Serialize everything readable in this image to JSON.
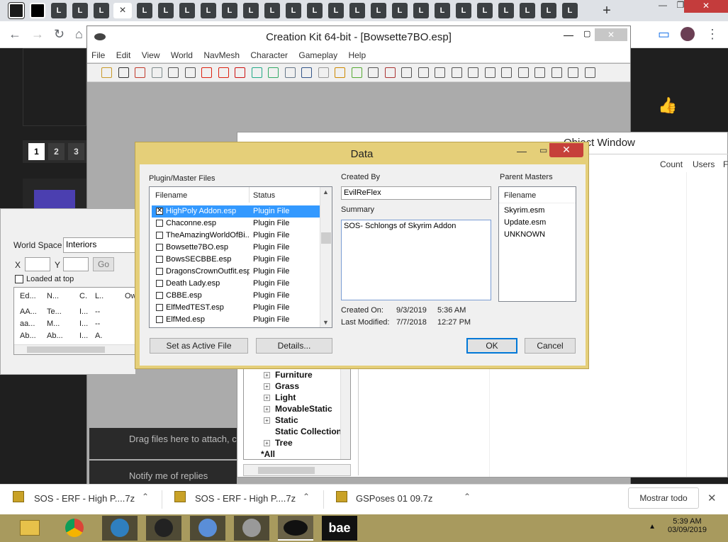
{
  "browser": {
    "tab_letter": "L",
    "active_tab_close": "×",
    "new_tab": "+",
    "window_min": "—",
    "window_max": "❐",
    "window_close": "✕"
  },
  "site": {
    "pager": [
      "1",
      "2",
      "3"
    ],
    "drag_text": "Drag files here to attach, c",
    "notify_text": "Notify me of replies"
  },
  "ck": {
    "title": "Creation Kit 64-bit - [Bowsette7BO.esp]",
    "menu": [
      "File",
      "Edit",
      "View",
      "World",
      "NavMesh",
      "Character",
      "Gameplay",
      "Help"
    ]
  },
  "object_window": {
    "title": "Object Window",
    "columns": [
      "Count",
      "Users",
      "Fo"
    ],
    "tree": [
      {
        "label": "Furniture",
        "expand": true
      },
      {
        "label": "Grass",
        "expand": true
      },
      {
        "label": "Light",
        "expand": true
      },
      {
        "label": "MovableStatic",
        "expand": true
      },
      {
        "label": "Static",
        "expand": true
      },
      {
        "label": "Static Collection",
        "expand": false
      },
      {
        "label": "Tree",
        "expand": true
      },
      {
        "label": "*All",
        "expand": false
      }
    ]
  },
  "cell_window": {
    "world_space_label": "World Space",
    "world_space_value": "Interiors",
    "x_label": "X",
    "y_label": "Y",
    "go": "Go",
    "loaded_at_top": "Loaded at top",
    "columns": [
      "Ed...",
      "N...",
      "C.",
      "L..",
      "Ow"
    ],
    "rows": [
      [
        "AA...",
        "Te...",
        "I...",
        "--"
      ],
      [
        "aa...",
        "M...",
        "I...",
        "--"
      ],
      [
        "Ab...",
        "Ab...",
        "I...",
        "A."
      ]
    ]
  },
  "dialog": {
    "title": "Data",
    "plugin_section": "Plugin/Master Files",
    "col_filename": "Filename",
    "col_status": "Status",
    "files": [
      {
        "name": "HighPoly Addon.esp",
        "status": "Plugin File",
        "checked": true,
        "selected": true
      },
      {
        "name": "Chaconne.esp",
        "status": "Plugin File",
        "checked": false,
        "selected": false
      },
      {
        "name": "TheAmazingWorldOfBi...",
        "status": "Plugin File",
        "checked": false,
        "selected": false
      },
      {
        "name": "Bowsette7BO.esp",
        "status": "Plugin File",
        "checked": false,
        "selected": false
      },
      {
        "name": "BowsSECBBE.esp",
        "status": "Plugin File",
        "checked": false,
        "selected": false
      },
      {
        "name": "DragonsCrownOutfit.esp",
        "status": "Plugin File",
        "checked": false,
        "selected": false
      },
      {
        "name": "Death Lady.esp",
        "status": "Plugin File",
        "checked": false,
        "selected": false
      },
      {
        "name": "CBBE.esp",
        "status": "Plugin File",
        "checked": false,
        "selected": false
      },
      {
        "name": "ElfMedTEST.esp",
        "status": "Plugin File",
        "checked": false,
        "selected": false
      },
      {
        "name": "ElfMed.esp",
        "status": "Plugin File",
        "checked": false,
        "selected": false
      }
    ],
    "created_by_label": "Created By",
    "created_by": "EvilReFlex",
    "summary_label": "Summary",
    "summary": "SOS- Schlongs of Skyrim Addon",
    "created_on_label": "Created On:",
    "created_on_date": "9/3/2019",
    "created_on_time": "5:36 AM",
    "modified_label": "Last Modified:",
    "modified_date": "7/7/2018",
    "modified_time": "12:27 PM",
    "parent_masters_label": "Parent Masters",
    "masters_col": "Filename",
    "masters": [
      "Skyrim.esm",
      "Update.esm",
      "UNKNOWN"
    ],
    "set_active": "Set as Active File",
    "details": "Details...",
    "ok": "OK",
    "cancel": "Cancel"
  },
  "downloads": {
    "items": [
      "SOS - ERF - High P....7z",
      "SOS - ERF - High P....7z",
      "GSPoses 01 09.7z"
    ],
    "show_all": "Mostrar todo",
    "close": "✕"
  },
  "taskbar": {
    "time": "5:39 AM",
    "date": "03/09/2019",
    "bae": "bae"
  },
  "colors": {
    "dialog_frame": "#e5cf79",
    "selection": "#3399ff",
    "taskbar": "#a89a5e",
    "close_red": "#c6403a"
  }
}
